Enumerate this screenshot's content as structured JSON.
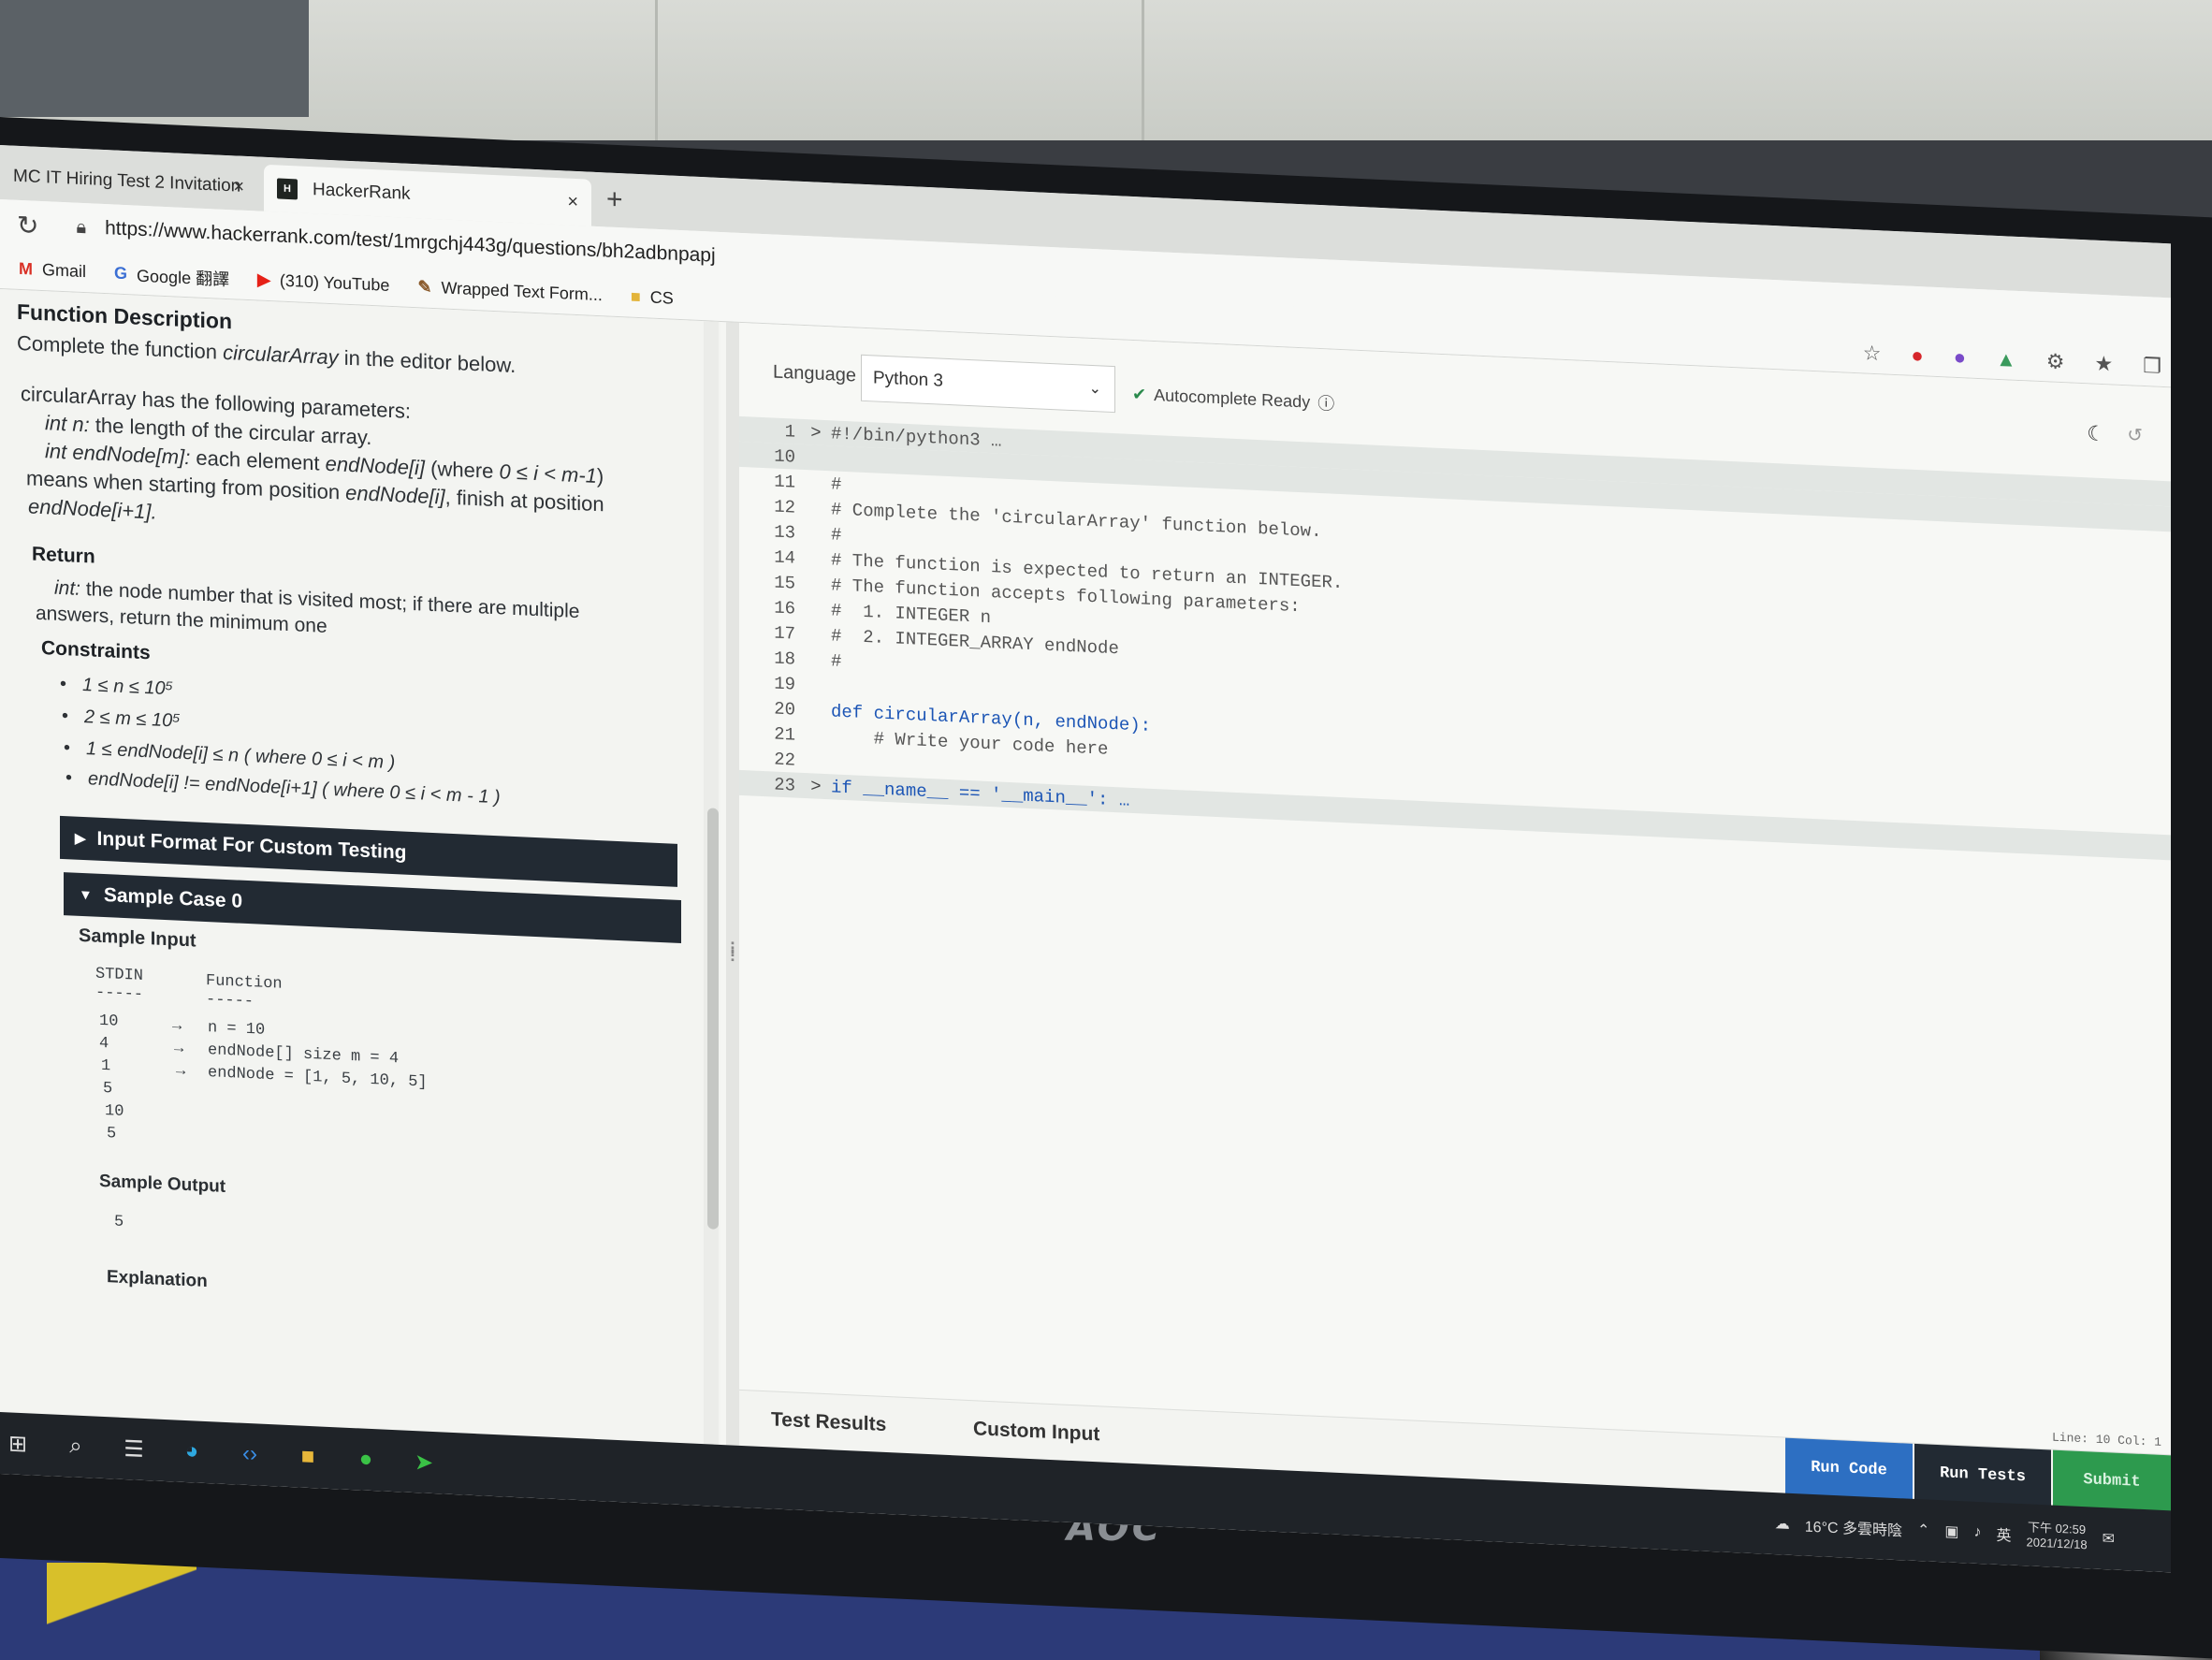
{
  "browser": {
    "tabs": [
      {
        "label": "MC IT Hiring Test 2 Invitation",
        "close": "×"
      },
      {
        "label": "HackerRank",
        "close": "×",
        "favicon": "H"
      }
    ],
    "new_tab": "+",
    "url": "https://www.hackerrank.com/test/1mrgchj443g/questions/bh2adbnpapj",
    "bookmarks": [
      {
        "icon": "M",
        "label": "Gmail",
        "color": "#d93025"
      },
      {
        "icon": "G",
        "label": "Google 翻譯",
        "color": "#3b6fd4"
      },
      {
        "icon": "▶",
        "label": "(310) YouTube",
        "color": "#e62117"
      },
      {
        "icon": "✎",
        "label": "Wrapped Text Form...",
        "color": "#8a5a2b"
      },
      {
        "icon": "■",
        "label": "CS",
        "color": "#e3b43a"
      }
    ]
  },
  "problem": {
    "func_desc_title": "Function Description",
    "func_desc_pre": "Complete the function ",
    "func_name": "circularArray",
    "func_desc_post": " in the editor below.",
    "params_intro": "circularArray has the following parameters:",
    "param1_name": "int n:",
    "param1_desc": " the length of the circular array.",
    "param2_name": "int endNode[m]:",
    "param2_desc1": " each element ",
    "param2_elem": "endNode[i]",
    "param2_desc2": " (where ",
    "param2_cond": "0 ≤ i < m-1",
    "param2_desc3": ")",
    "param2_line2_pre": "means when starting from position ",
    "param2_line2_elem": "endNode[i]",
    "param2_line2_post": ", finish at position",
    "param2_line3": "endNode[i+1].",
    "return_title": "Return",
    "return_type": "int:",
    "return_desc1": " the node number that is visited most; if there are multiple",
    "return_desc2": "answers, return the minimum one",
    "constraints_title": "Constraints",
    "constraints": [
      "1 ≤ n ≤ 10⁵",
      "2 ≤ m ≤ 10⁵",
      "1 ≤ endNode[i] ≤ n ( where  0 ≤ i < m )",
      "endNode[i] != endNode[i+1] ( where  0 ≤ i <  m - 1 )"
    ],
    "accordion_custom": "Input Format For Custom Testing",
    "accordion_sample": "Sample Case 0",
    "sample_input_title": "Sample Input",
    "stdin_header": "STDIN",
    "function_header": "Function",
    "dashes1": "-----",
    "dashes2": "-----",
    "stdin_rows": [
      "10",
      "4",
      "1",
      "5",
      "10",
      "5"
    ],
    "arrows": [
      "→",
      "→",
      "→"
    ],
    "function_rows": [
      "n = 10",
      "endNode[] size m = 4",
      "endNode = [1, 5, 10, 5]"
    ],
    "sample_output_title": "Sample Output",
    "sample_output": "5",
    "explanation_title": "Explanation"
  },
  "editor": {
    "language_label": "Language",
    "language_value": "Python 3",
    "autocomplete": "Autocomplete Ready",
    "status_line": "Line: 10 Col: 1",
    "lines": [
      {
        "num": "1",
        "fold": ">",
        "text": "#!/bin/python3 …",
        "cls": "cm",
        "hl": true
      },
      {
        "num": "10",
        "fold": "",
        "text": "",
        "cls": "",
        "hl": true
      },
      {
        "num": "11",
        "fold": "",
        "text": "#",
        "cls": "cm",
        "hl": false
      },
      {
        "num": "12",
        "fold": "",
        "text": "# Complete the 'circularArray' function below.",
        "cls": "cm",
        "hl": false
      },
      {
        "num": "13",
        "fold": "",
        "text": "#",
        "cls": "cm",
        "hl": false
      },
      {
        "num": "14",
        "fold": "",
        "text": "# The function is expected to return an INTEGER.",
        "cls": "cm",
        "hl": false
      },
      {
        "num": "15",
        "fold": "",
        "text": "# The function accepts following parameters:",
        "cls": "cm",
        "hl": false
      },
      {
        "num": "16",
        "fold": "",
        "text": "#  1. INTEGER n",
        "cls": "cm",
        "hl": false
      },
      {
        "num": "17",
        "fold": "",
        "text": "#  2. INTEGER_ARRAY endNode",
        "cls": "cm",
        "hl": false
      },
      {
        "num": "18",
        "fold": "",
        "text": "#",
        "cls": "cm",
        "hl": false
      },
      {
        "num": "19",
        "fold": "",
        "text": "",
        "cls": "",
        "hl": false
      },
      {
        "num": "20",
        "fold": "",
        "text": "def circularArray(n, endNode):",
        "cls": "kw",
        "hl": false
      },
      {
        "num": "21",
        "fold": "",
        "text": "    # Write your code here",
        "cls": "cm",
        "hl": false
      },
      {
        "num": "22",
        "fold": "",
        "text": "",
        "cls": "",
        "hl": false
      },
      {
        "num": "23",
        "fold": ">",
        "text": "if __name__ == '__main__': …",
        "cls": "kw",
        "hl": true
      }
    ],
    "tab_test_results": "Test Results",
    "tab_custom_input": "Custom Input",
    "btn_run_code": "Run Code",
    "btn_run_tests": "Run Tests",
    "btn_submit": "Submit"
  },
  "taskbar": {
    "weather": "16°C 多雲時陰",
    "ime": "英",
    "time": "下午 02:59",
    "date": "2021/12/18"
  },
  "monitor_brand": "AOC"
}
